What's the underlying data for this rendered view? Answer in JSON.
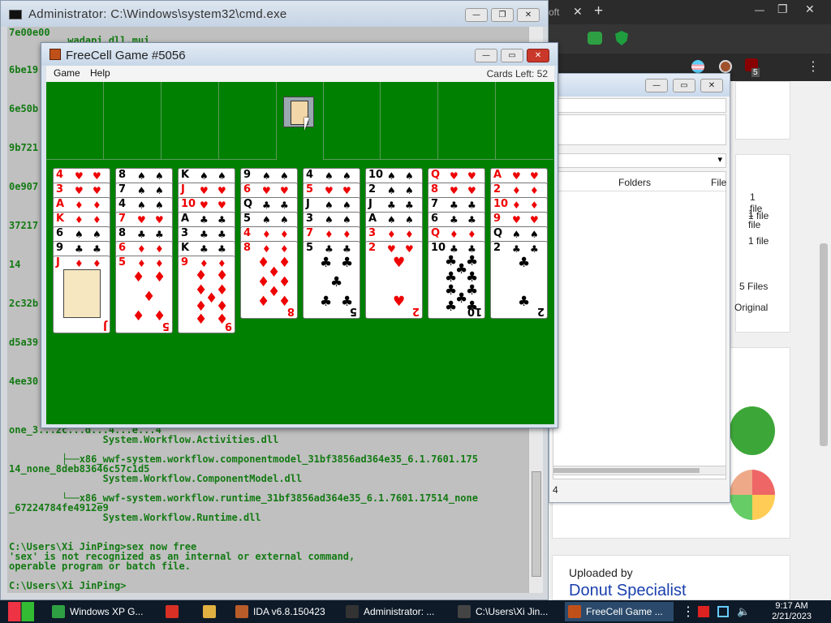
{
  "browser": {
    "tab_partial": "oft",
    "tab_close": "✕",
    "new_tab": "+",
    "win_min": "—",
    "win_max": "❐",
    "win_close": "✕",
    "ext_badge": "5",
    "menu_glyph": "⋮"
  },
  "explorer": {
    "col_folders": "Folders",
    "col_file": "File",
    "rows": [
      {
        "value": "1 file"
      },
      {
        "value": "1 file"
      },
      {
        "value": "5 Files"
      },
      {
        "value": "Original"
      }
    ],
    "status": "4"
  },
  "page_bottom": {
    "uploaded_by": "Uploaded by",
    "author": "Donut Specialist"
  },
  "cmd": {
    "title": "Administrator: C:\\Windows\\system32\\cmd.exe",
    "lines": [
      "7e00e00",
      "          wadapi.dll.mui",
      "6be19",
      "6e50b",
      "9b721",
      "0e907",
      "37217",
      "14",
      "2c32b",
      "d5a39",
      "4ee30",
      "one_3...2c...d...4...e...4",
      "                System.Workflow.Activities.dll",
      "         ├──x86_wwf-system.workflow.componentmodel_31bf3856ad364e35_6.1.7601.175",
      "14_none_8deb83646c57c1d5",
      "                System.Workflow.ComponentModel.dll",
      "         └──x86_wwf-system.workflow.runtime_31bf3856ad364e35_6.1.7601.17514_none",
      "_67224784fe4912e9",
      "                System.Workflow.Runtime.dll",
      "",
      "C:\\Users\\Xi JinPing>sex now free",
      "'sex' is not recognized as an internal or external command,",
      "operable program or batch file.",
      "",
      "C:\\Users\\Xi JinPing>"
    ]
  },
  "freecell": {
    "title": "FreeCell Game #5056",
    "menu": [
      "Game",
      "Help"
    ],
    "cards_left": "Cards Left: 52",
    "columns": [
      [
        [
          "4",
          "♥",
          "red"
        ],
        [
          "3",
          "♥",
          "red"
        ],
        [
          "A",
          "♦",
          "red"
        ],
        [
          "K",
          "♦",
          "red"
        ],
        [
          "6",
          "♠",
          "blk"
        ],
        [
          "9",
          "♣",
          "blk"
        ],
        [
          "J",
          "♦",
          "red"
        ]
      ],
      [
        [
          "8",
          "♠",
          "blk"
        ],
        [
          "7",
          "♠",
          "blk"
        ],
        [
          "4",
          "♠",
          "blk"
        ],
        [
          "7",
          "♥",
          "red"
        ],
        [
          "8",
          "♣",
          "blk"
        ],
        [
          "6",
          "♦",
          "red"
        ],
        [
          "5",
          "♦",
          "red"
        ]
      ],
      [
        [
          "K",
          "♠",
          "blk"
        ],
        [
          "J",
          "♥",
          "red"
        ],
        [
          "10",
          "♥",
          "red"
        ],
        [
          "A",
          "♣",
          "blk"
        ],
        [
          "3",
          "♣",
          "blk"
        ],
        [
          "K",
          "♣",
          "blk"
        ],
        [
          "9",
          "♦",
          "red"
        ]
      ],
      [
        [
          "9",
          "♠",
          "blk"
        ],
        [
          "6",
          "♥",
          "red"
        ],
        [
          "Q",
          "♣",
          "blk"
        ],
        [
          "5",
          "♠",
          "blk"
        ],
        [
          "4",
          "♦",
          "red"
        ],
        [
          "8",
          "♦",
          "red"
        ]
      ],
      [
        [
          "4",
          "♠",
          "blk"
        ],
        [
          "5",
          "♥",
          "red"
        ],
        [
          "J",
          "♠",
          "blk"
        ],
        [
          "3",
          "♠",
          "blk"
        ],
        [
          "7",
          "♦",
          "red"
        ],
        [
          "5",
          "♣",
          "blk"
        ]
      ],
      [
        [
          "10",
          "♠",
          "blk"
        ],
        [
          "2",
          "♠",
          "blk"
        ],
        [
          "J",
          "♣",
          "blk"
        ],
        [
          "A",
          "♠",
          "blk"
        ],
        [
          "3",
          "♦",
          "red"
        ],
        [
          "2",
          "♥",
          "red"
        ]
      ],
      [
        [
          "Q",
          "♥",
          "red"
        ],
        [
          "8",
          "♥",
          "red"
        ],
        [
          "7",
          "♣",
          "blk"
        ],
        [
          "6",
          "♣",
          "blk"
        ],
        [
          "Q",
          "♦",
          "red"
        ],
        [
          "10",
          "♣",
          "blk"
        ]
      ],
      [
        [
          "A",
          "♥",
          "red"
        ],
        [
          "2",
          "♦",
          "red"
        ],
        [
          "10",
          "♦",
          "red"
        ],
        [
          "9",
          "♥",
          "red"
        ],
        [
          "Q",
          "♠",
          "blk"
        ],
        [
          "2",
          "♣",
          "blk"
        ]
      ]
    ]
  },
  "taskbar": {
    "items": [
      {
        "label": "Windows XP G...",
        "color": "#2ea043"
      },
      {
        "label": "",
        "color": "#d93025"
      },
      {
        "label": "",
        "color": "#e0b040"
      },
      {
        "label": "IDA v6.8.150423",
        "color": "#b85c2a"
      },
      {
        "label": "Administrator: ...",
        "color": "#333333"
      },
      {
        "label": "C:\\Users\\Xi Jin...",
        "color": "#444444"
      },
      {
        "label": "FreeCell Game ...",
        "color": "#c0501a"
      }
    ],
    "time": "9:17 AM",
    "date": "2/21/2023"
  }
}
